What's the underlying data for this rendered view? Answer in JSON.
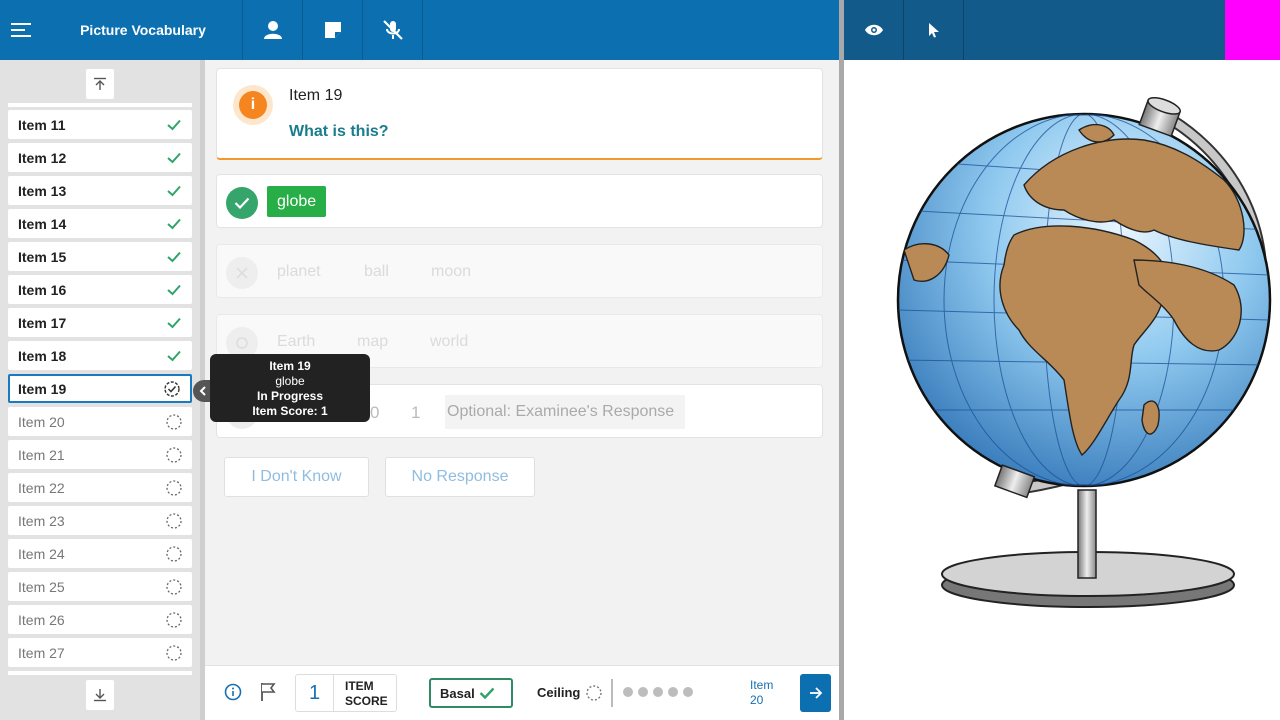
{
  "header": {
    "title": "Picture Vocabulary",
    "icons": [
      "menu-icon",
      "person-icon",
      "note-icon",
      "mic-off-icon"
    ]
  },
  "right_toolbar": {
    "icons": [
      "eye-icon",
      "pointer-icon"
    ],
    "accent": "#ff00ff"
  },
  "sidebar": {
    "items": [
      {
        "label": "Item 11",
        "status": "done"
      },
      {
        "label": "Item 12",
        "status": "done"
      },
      {
        "label": "Item 13",
        "status": "done"
      },
      {
        "label": "Item 14",
        "status": "done"
      },
      {
        "label": "Item 15",
        "status": "done"
      },
      {
        "label": "Item 16",
        "status": "done"
      },
      {
        "label": "Item 17",
        "status": "done"
      },
      {
        "label": "Item 18",
        "status": "done"
      },
      {
        "label": "Item 19",
        "status": "current"
      },
      {
        "label": "Item 20",
        "status": "pending"
      },
      {
        "label": "Item 21",
        "status": "pending"
      },
      {
        "label": "Item 22",
        "status": "pending"
      },
      {
        "label": "Item 23",
        "status": "pending"
      },
      {
        "label": "Item 24",
        "status": "pending"
      },
      {
        "label": "Item 25",
        "status": "pending"
      },
      {
        "label": "Item 26",
        "status": "pending"
      },
      {
        "label": "Item 27",
        "status": "pending"
      }
    ]
  },
  "question": {
    "title": "Item 19",
    "prompt": "What is this?"
  },
  "answers": {
    "correct": "globe",
    "row2": [
      "planet",
      "ball",
      "moon"
    ],
    "row3": [
      "Earth",
      "map",
      "world"
    ],
    "scores": [
      "0",
      "1"
    ],
    "response_placeholder": "Optional: Examinee's Response"
  },
  "buttons": {
    "dont_know": "I Don't Know",
    "no_response": "No Response"
  },
  "tooltip": {
    "title": "Item 19",
    "answer": "globe",
    "status": "In Progress",
    "score": "Item Score: 1"
  },
  "footer": {
    "item_score_value": "1",
    "item_score_label_1": "ITEM",
    "item_score_label_2": "SCORE",
    "basal": "Basal",
    "ceiling": "Ceiling",
    "next_label_1": "Item",
    "next_label_2": "20",
    "dots": 5
  },
  "colors": {
    "header": "#0b6fb0",
    "correct": "#27ae46",
    "prompt": "#1b7c8e",
    "info": "#f5861f"
  }
}
